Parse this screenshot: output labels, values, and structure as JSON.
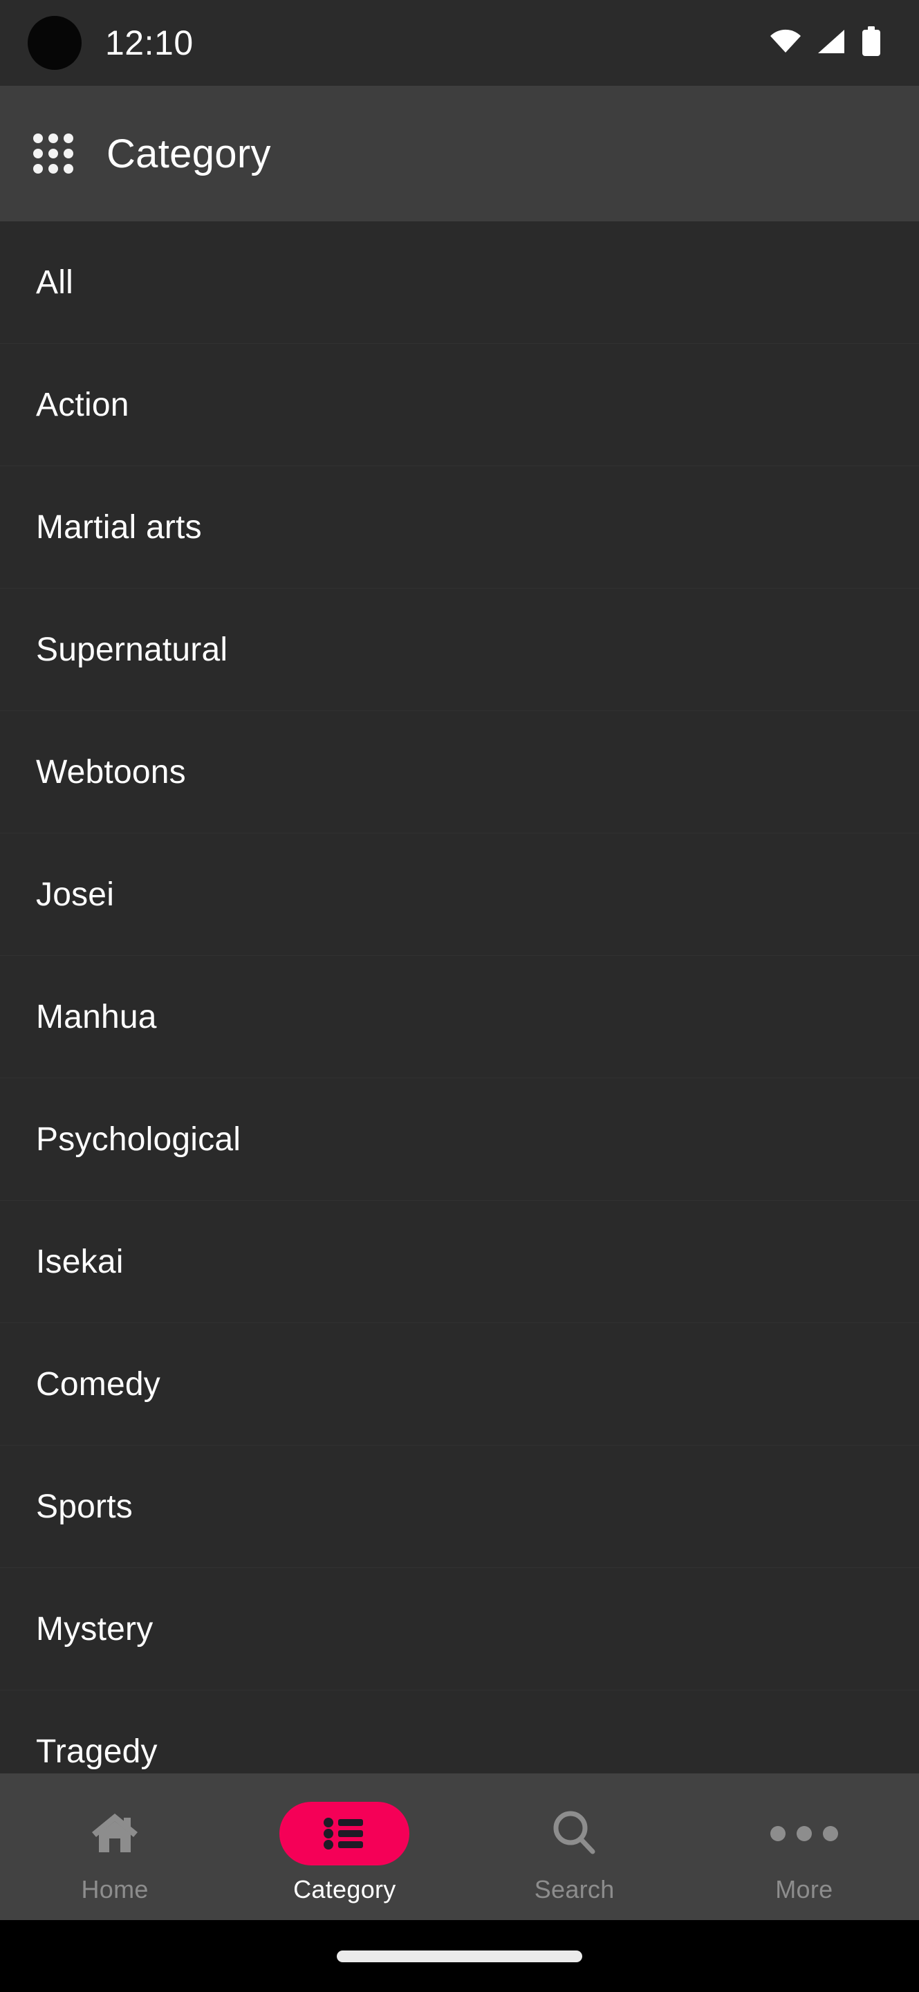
{
  "statusbar": {
    "time": "12:10",
    "notification_badge": "notification-dot",
    "icons": [
      "wifi-icon",
      "cellular-signal-icon",
      "battery-icon"
    ]
  },
  "header": {
    "menu_icon": "grid-apps-icon",
    "title": "Category"
  },
  "list": {
    "items": [
      {
        "label": "All"
      },
      {
        "label": "Action"
      },
      {
        "label": "Martial arts"
      },
      {
        "label": "Supernatural"
      },
      {
        "label": "Webtoons"
      },
      {
        "label": "Josei"
      },
      {
        "label": "Manhua"
      },
      {
        "label": "Psychological"
      },
      {
        "label": "Isekai"
      },
      {
        "label": "Comedy"
      },
      {
        "label": "Sports"
      },
      {
        "label": "Mystery"
      },
      {
        "label": "Tragedy"
      }
    ]
  },
  "bottomnav": {
    "active": "Category",
    "accent_color": "#f50057",
    "inactive_color": "#8d8d8d",
    "items": [
      {
        "label": "Home",
        "icon": "home-icon"
      },
      {
        "label": "Category",
        "icon": "list-icon"
      },
      {
        "label": "Search",
        "icon": "search-icon"
      },
      {
        "label": "More",
        "icon": "more-horizontal-icon"
      }
    ]
  },
  "gesture_bar": {
    "name": "home-indicator"
  }
}
